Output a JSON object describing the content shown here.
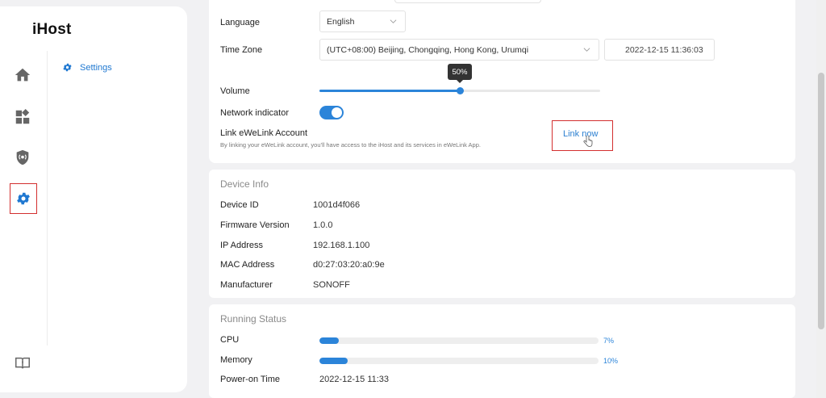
{
  "app": {
    "title": "iHost"
  },
  "sidebar": {
    "nav": [
      {
        "icon": "home-icon"
      },
      {
        "icon": "widgets-icon"
      },
      {
        "icon": "shield-icon"
      },
      {
        "icon": "gear-icon",
        "active": true
      }
    ],
    "bottom_icon": "manual-icon",
    "sub_items": [
      {
        "label": "Settings",
        "icon": "gear-icon"
      }
    ]
  },
  "settings": {
    "language_label": "Language",
    "language_value": "English",
    "timezone_label": "Time Zone",
    "timezone_value": "(UTC+08:00) Beijing, Chongqing, Hong Kong, Urumqi",
    "current_time": "2022-12-15 11:36:03",
    "volume_label": "Volume",
    "volume_value": 50,
    "volume_display": "50%",
    "network_indicator_label": "Network indicator",
    "network_indicator_on": true,
    "link_title": "Link eWeLink Account",
    "link_desc": "By linking your eWeLink account, you'll have access to the iHost and its services in eWeLink App.",
    "link_button": "Link now"
  },
  "device_info": {
    "title": "Device Info",
    "rows": [
      {
        "label": "Device ID",
        "value": "1001d4f066"
      },
      {
        "label": "Firmware Version",
        "value": "1.0.0"
      },
      {
        "label": "IP Address",
        "value": "192.168.1.100"
      },
      {
        "label": "MAC Address",
        "value": "d0:27:03:20:a0:9e"
      },
      {
        "label": "Manufacturer",
        "value": "SONOFF"
      }
    ]
  },
  "running_status": {
    "title": "Running Status",
    "cpu_label": "CPU",
    "cpu_value": 7,
    "cpu_display": "7%",
    "memory_label": "Memory",
    "memory_value": 10,
    "memory_display": "10%",
    "power_on_label": "Power-on Time",
    "power_on_value": "2022-12-15 11:33"
  },
  "colors": {
    "accent": "#2b84d9",
    "highlight_box": "#d32f2f"
  }
}
